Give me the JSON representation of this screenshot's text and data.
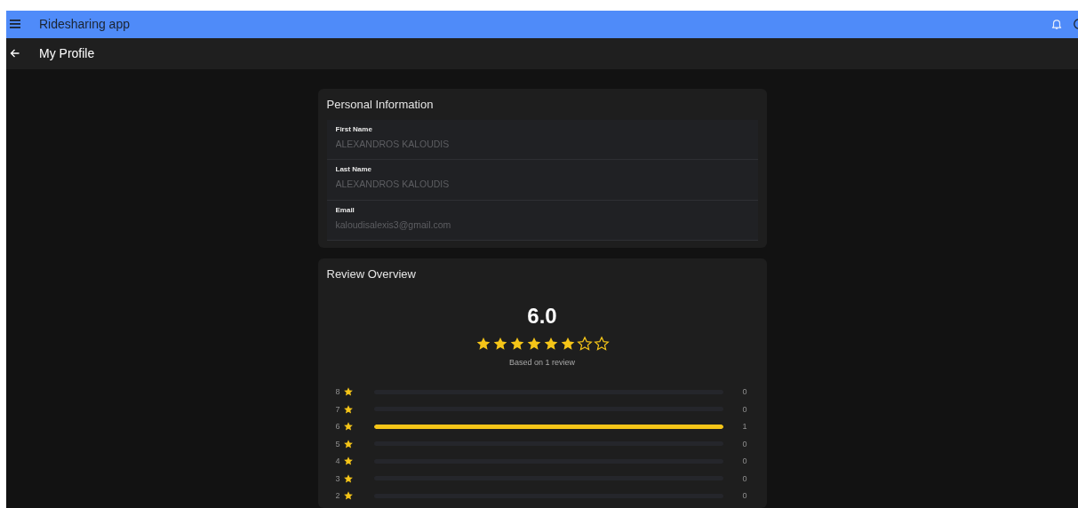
{
  "app_bar": {
    "title": "Ridesharing app"
  },
  "sub_bar": {
    "title": "My Profile"
  },
  "personal_information": {
    "title": "Personal Information",
    "fields": [
      {
        "label": "First Name",
        "value": "ALEXANDROS KALOUDIS"
      },
      {
        "label": "Last Name",
        "value": "ALEXANDROS KALOUDIS"
      },
      {
        "label": "Email",
        "value": "kaloudisalexis3@gmail.com"
      }
    ]
  },
  "review_overview": {
    "title": "Review Overview",
    "average": "6.0",
    "stars": 6,
    "summary": "Based on 1 review",
    "rows": [
      {
        "label": "8",
        "level": 0,
        "count": "0"
      },
      {
        "label": "7",
        "level": 0,
        "count": "0"
      },
      {
        "label": "6",
        "level": 1,
        "count": "1"
      },
      {
        "label": "5",
        "level": 0,
        "count": "0"
      },
      {
        "label": "4",
        "level": 0,
        "count": "0"
      },
      {
        "label": "3",
        "level": 0,
        "count": "0"
      },
      {
        "label": "2",
        "level": 0,
        "count": "0"
      }
    ]
  }
}
